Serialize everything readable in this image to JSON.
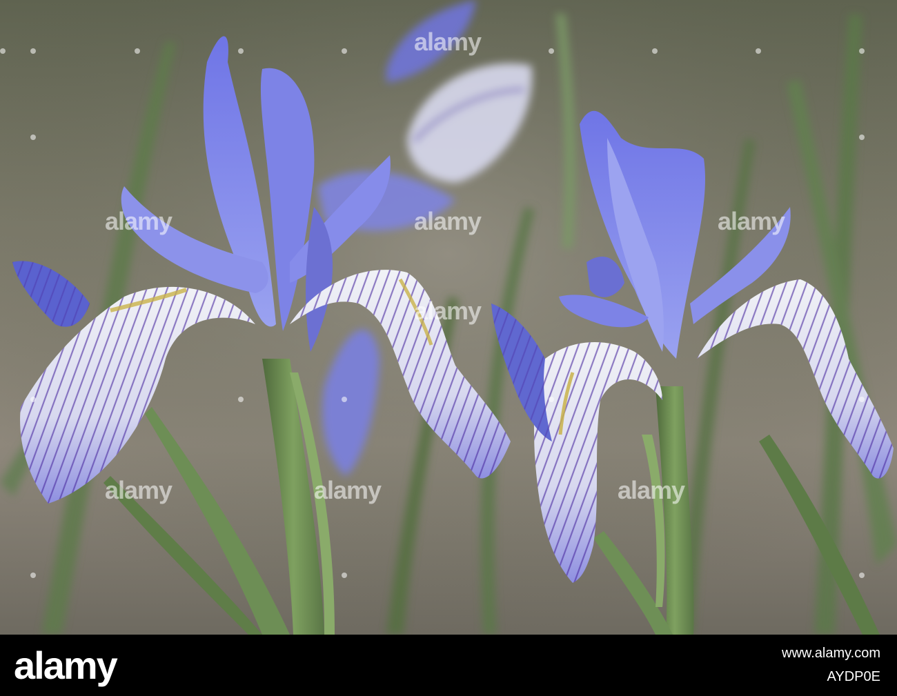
{
  "watermark": {
    "text": "alamy",
    "color": "#ffffff"
  },
  "footer": {
    "logo_text": "alamy",
    "image_id": "AYDP0E",
    "domain": "www.alamy.com",
    "background": "#000000"
  },
  "photo": {
    "subject": "blue-violet iris flowers",
    "palette": {
      "background_sky": "#6f7560",
      "background_ground": "#8a8579",
      "leaf": "#6b8a4e",
      "petal_blue": "#7378e0",
      "petal_light": "#9aa0ee",
      "fall_white": "#e6e8f2",
      "vein_purple": "#4a2a9a",
      "signal_yellow": "#c9b34a"
    }
  }
}
